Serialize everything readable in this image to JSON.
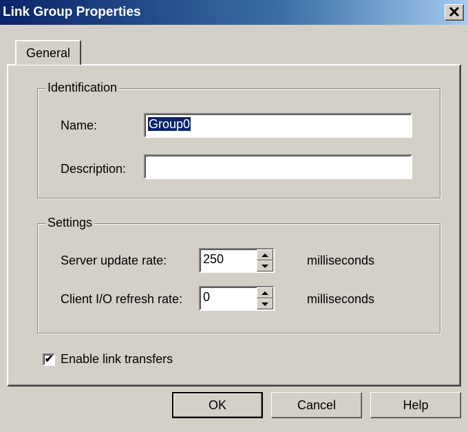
{
  "window": {
    "title": "Link Group Properties",
    "close_glyph": "✕"
  },
  "tabs": [
    {
      "label": "General",
      "active": true
    }
  ],
  "identification": {
    "label": "Identification",
    "name_label": "Name:",
    "name_value": "Group0",
    "description_label": "Description:",
    "description_value": ""
  },
  "settings": {
    "label": "Settings",
    "server_update_label": "Server update rate:",
    "server_update_value": "250",
    "server_update_unit": "milliseconds",
    "client_refresh_label": "Client I/O refresh rate:",
    "client_refresh_value": "0",
    "client_refresh_unit": "milliseconds"
  },
  "enable_link_transfers": {
    "label": "Enable link transfers",
    "checked": true,
    "check_glyph": "✔"
  },
  "buttons": {
    "ok": "OK",
    "cancel": "Cancel",
    "help": "Help"
  }
}
